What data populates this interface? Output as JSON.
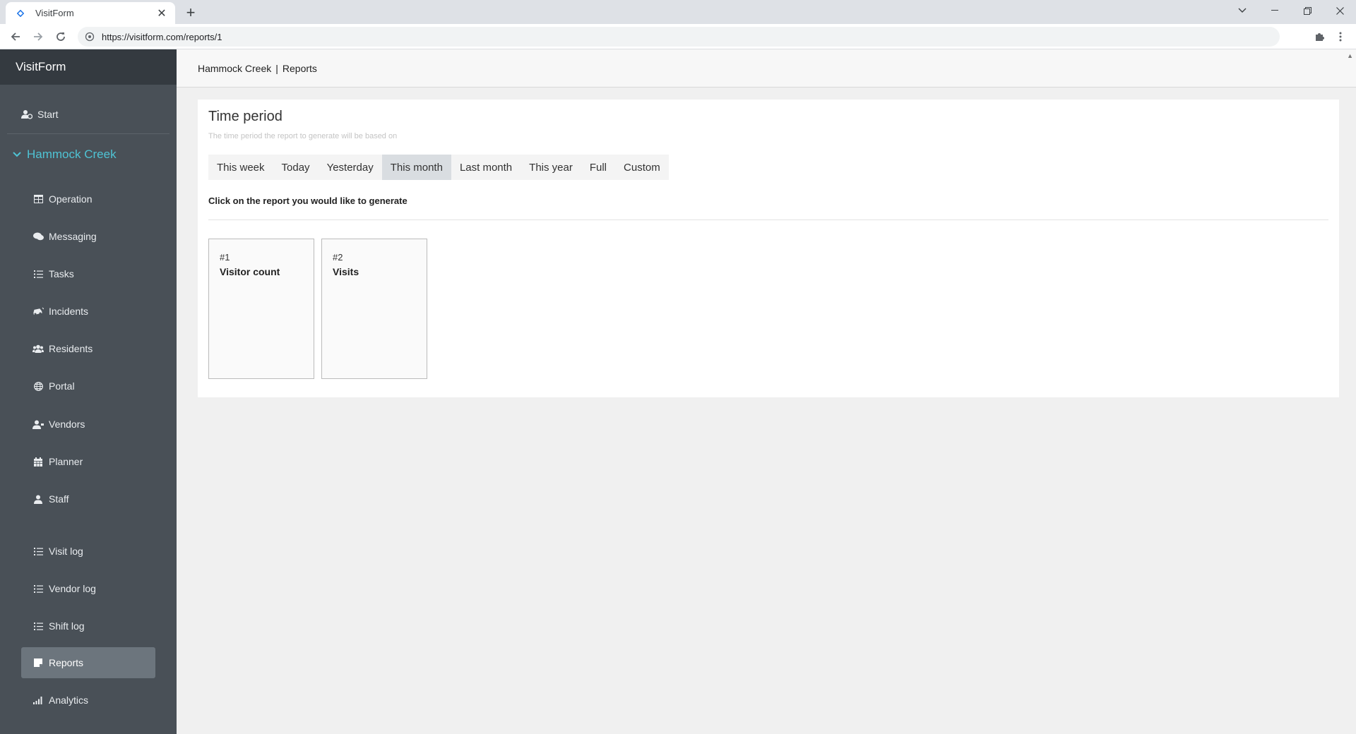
{
  "browser": {
    "tab_title": "VisitForm",
    "url": "https://visitform.com/reports/1"
  },
  "sidebar": {
    "brand": "VisitForm",
    "start": "Start",
    "group": "Hammock Creek",
    "items": [
      {
        "label": "Operation",
        "icon": "table-icon"
      },
      {
        "label": "Messaging",
        "icon": "comments-icon"
      },
      {
        "label": "Tasks",
        "icon": "list-icon"
      },
      {
        "label": "Incidents",
        "icon": "car-crash-icon"
      },
      {
        "label": "Residents",
        "icon": "users-icon"
      },
      {
        "label": "Portal",
        "icon": "globe-icon"
      },
      {
        "label": "Vendors",
        "icon": "user-tie-icon"
      },
      {
        "label": "Planner",
        "icon": "calendar-icon"
      },
      {
        "label": "Staff",
        "icon": "user-icon"
      },
      {
        "label": "Visit log",
        "icon": "list-icon"
      },
      {
        "label": "Vendor log",
        "icon": "list-icon"
      },
      {
        "label": "Shift log",
        "icon": "list-icon"
      },
      {
        "label": "Reports",
        "icon": "sticky-note-icon",
        "active": true
      },
      {
        "label": "Analytics",
        "icon": "signal-icon"
      }
    ]
  },
  "header": {
    "breadcrumb_site": "Hammock Creek",
    "breadcrumb_sep": "|",
    "breadcrumb_page": "Reports"
  },
  "time_period": {
    "title": "Time period",
    "subtitle": "The time period the report to generate will be based on",
    "options": [
      "This week",
      "Today",
      "Yesterday",
      "This month",
      "Last month",
      "This year",
      "Full",
      "Custom"
    ],
    "selected": "This month"
  },
  "reports_section": {
    "instruction": "Click on the report you would like to generate",
    "reports": [
      {
        "number": "#1",
        "name": "Visitor count"
      },
      {
        "number": "#2",
        "name": "Visits"
      }
    ]
  },
  "colors": {
    "sidebar_bg": "#495057",
    "brand_bg": "#343a40",
    "accent": "#4fc3d4",
    "active_item": "#6c757d"
  }
}
